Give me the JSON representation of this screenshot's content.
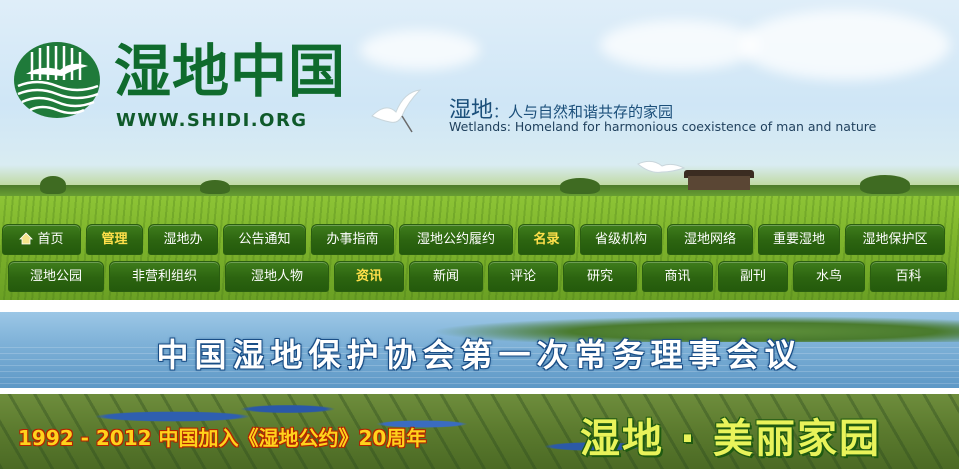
{
  "header": {
    "logo_cn": "湿地中国",
    "logo_url": "WWW.SHIDI.ORG",
    "slogan_cn_main": "湿地",
    "slogan_cn_sub": "：人与自然和谐共存的家园",
    "slogan_en": "Wetlands: Homeland for harmonious coexistence of man and nature"
  },
  "nav": {
    "row1": [
      {
        "label": "首页",
        "icon": "home-icon",
        "highlight": false
      },
      {
        "label": "管理",
        "highlight": true
      },
      {
        "label": "湿地办",
        "highlight": false
      },
      {
        "label": "公告通知",
        "highlight": false
      },
      {
        "label": "办事指南",
        "highlight": false
      },
      {
        "label": "湿地公约履约",
        "highlight": false
      },
      {
        "label": "名录",
        "highlight": true
      },
      {
        "label": "省级机构",
        "highlight": false
      },
      {
        "label": "湿地网络",
        "highlight": false
      },
      {
        "label": "重要湿地",
        "highlight": false
      },
      {
        "label": "湿地保护区",
        "highlight": false
      }
    ],
    "row2": [
      {
        "label": "湿地公园",
        "highlight": false
      },
      {
        "label": "非营利组织",
        "highlight": false
      },
      {
        "label": "湿地人物",
        "highlight": false
      },
      {
        "label": "资讯",
        "highlight": true
      },
      {
        "label": "新闻",
        "highlight": false
      },
      {
        "label": "评论",
        "highlight": false
      },
      {
        "label": "研究",
        "highlight": false
      },
      {
        "label": "商讯",
        "highlight": false
      },
      {
        "label": "副刊",
        "highlight": false
      },
      {
        "label": "水鸟",
        "highlight": false
      },
      {
        "label": "百科",
        "highlight": false
      }
    ]
  },
  "banner1": {
    "title": "中国湿地保护协会第一次常务理事会议"
  },
  "banner2": {
    "left_text": "1992 - 2012 中国加入《湿地公约》20周年",
    "right_text": "湿地 · 美丽家园"
  },
  "colors": {
    "nav_bg": "#2c6410",
    "nav_text": "#ffffff",
    "nav_highlight": "#ffe04a",
    "logo_green": "#0f6b2d"
  }
}
